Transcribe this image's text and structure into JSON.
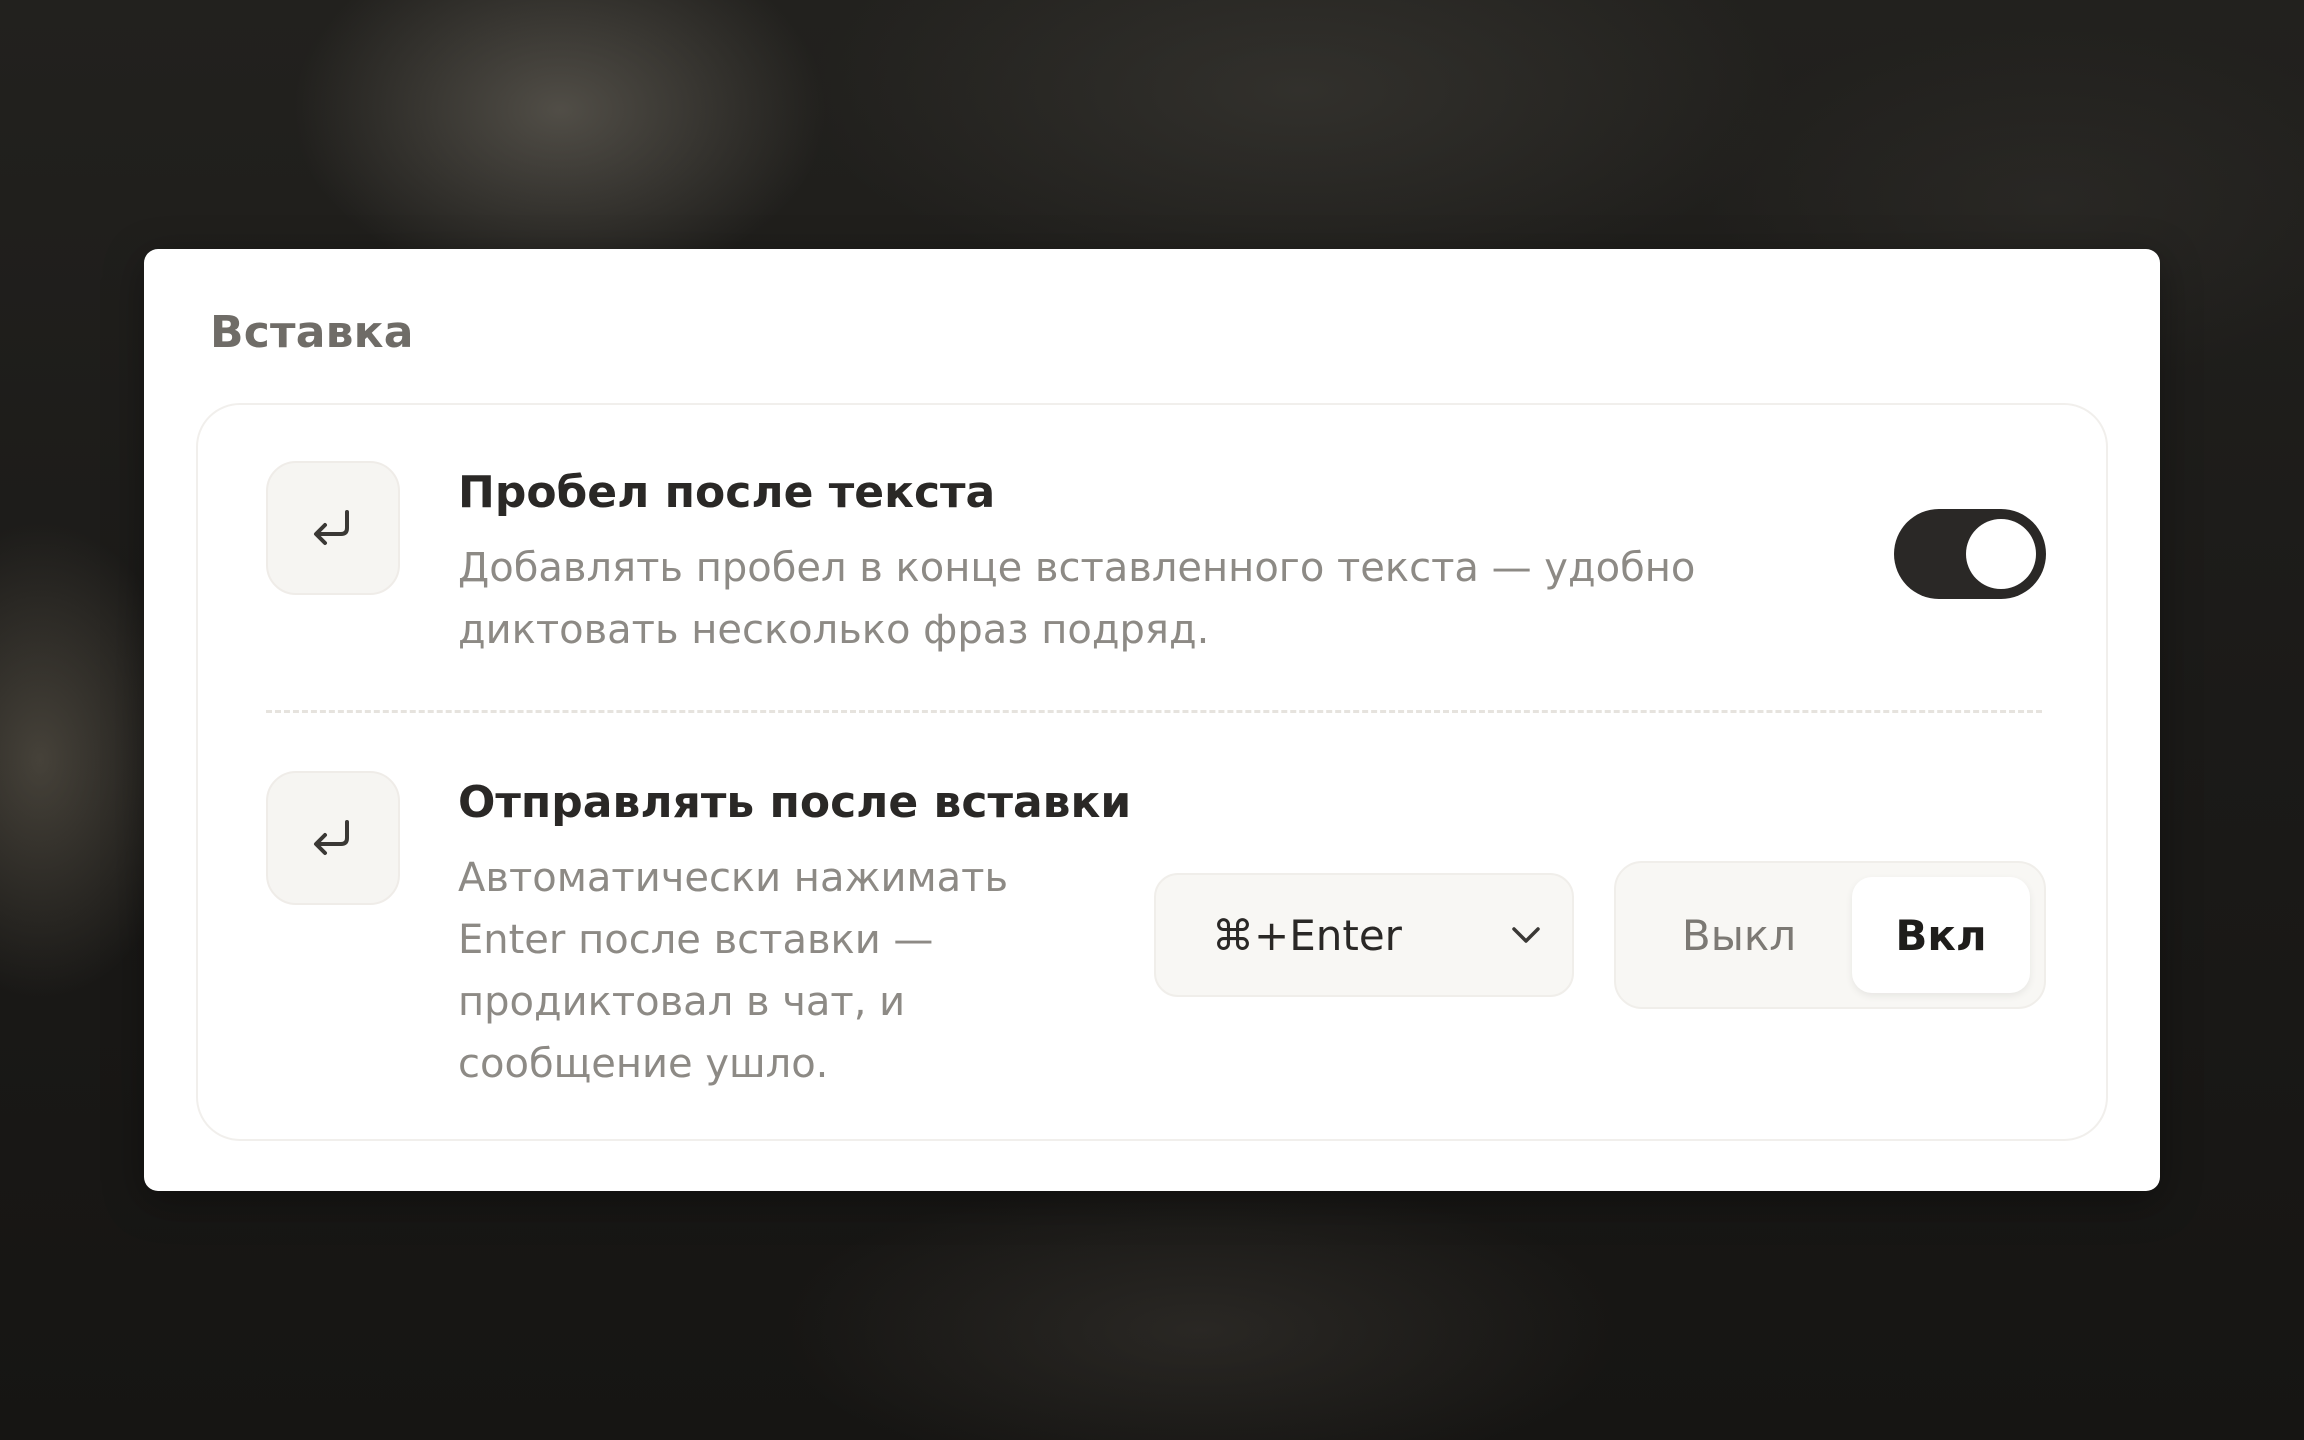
{
  "section": {
    "title": "Вставка"
  },
  "settings": [
    {
      "title": "Пробел после текста",
      "description": "Добавлять пробел в конце вставленного текста — удобно диктовать несколько фраз подряд.",
      "icon": "return-arrow-icon",
      "control": {
        "type": "toggle",
        "state": "on"
      }
    },
    {
      "title": "Отправлять после вставки",
      "description": "Автоматически нажимать Enter после вставки — продиктовал в чат, и сообщение ушло.",
      "icon": "return-arrow-icon",
      "shortcut_select": {
        "value": "⌘+Enter"
      },
      "segmented": {
        "options": [
          "Выкл",
          "Вкл"
        ],
        "selected": "Вкл"
      }
    }
  ],
  "colors": {
    "toggle_on": "#2a2826",
    "card_background": "#ffffff",
    "muted_text": "#8d8a85"
  }
}
